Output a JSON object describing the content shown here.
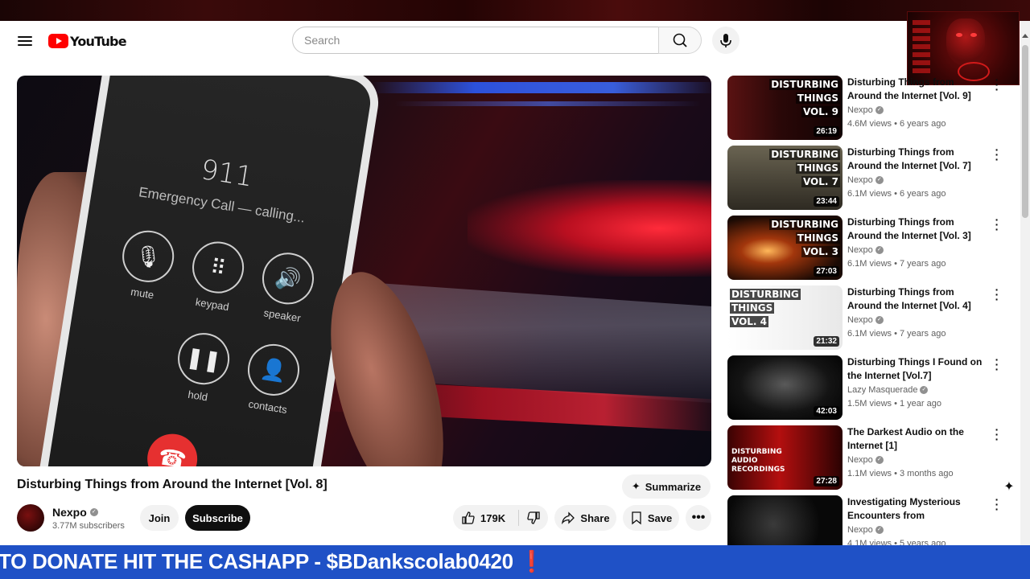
{
  "header": {
    "logo_text": "YouTube",
    "search_placeholder": "Search"
  },
  "player": {
    "call_number": "911",
    "call_status": "Emergency Call — calling...",
    "buttons": [
      "mute",
      "keypad",
      "speaker",
      "hold",
      "contacts"
    ]
  },
  "video": {
    "title": "Disturbing Things from Around the Internet [Vol. 8]",
    "summarize_label": "Summarize",
    "channel_name": "Nexpo",
    "subscribers": "3.77M subscribers",
    "join_label": "Join",
    "subscribe_label": "Subscribe",
    "likes": "179K",
    "share_label": "Share",
    "save_label": "Save"
  },
  "recommendations": [
    {
      "thumb_text": [
        "DISTURBING",
        "THINGS",
        "VOL. 9"
      ],
      "duration": "26:19",
      "title": "Disturbing Things from Around the Internet [Vol. 9]",
      "channel": "Nexpo",
      "meta": "4.6M views • 6 years ago",
      "bg": "#3a0c0c"
    },
    {
      "thumb_text": [
        "DISTURBING",
        "THINGS",
        "VOL. 7"
      ],
      "duration": "23:44",
      "title": "Disturbing Things from Around the Internet [Vol. 7]",
      "channel": "Nexpo",
      "meta": "6.1M views • 6 years ago",
      "bg": "#4a4638"
    },
    {
      "thumb_text": [
        "DISTURBING",
        "THINGS",
        "VOL. 3"
      ],
      "duration": "27:03",
      "title": "Disturbing Things from Around the Internet [Vol. 3]",
      "channel": "Nexpo",
      "meta": "6.1M views • 7 years ago",
      "bg": "#2a1408"
    },
    {
      "thumb_text": [
        "DISTURBING",
        "THINGS",
        "VOL. 4"
      ],
      "duration": "21:32",
      "title": "Disturbing Things from Around the Internet [Vol. 4]",
      "channel": "Nexpo",
      "meta": "6.1M views • 7 years ago",
      "bg": "#f4f4f4"
    },
    {
      "thumb_text": [],
      "duration": "42:03",
      "title": "Disturbing Things I Found on the Internet [Vol.7]",
      "channel": "Lazy Masquerade",
      "meta": "1.5M views • 1 year ago",
      "bg": "#111111"
    },
    {
      "thumb_text": [
        "DISTURBING",
        "AUDIO",
        "RECORDINGS"
      ],
      "duration": "27:28",
      "title": "The Darkest Audio on the Internet [1]",
      "channel": "Nexpo",
      "meta": "1.1M views • 3 months ago",
      "bg": "#8a0a0a"
    },
    {
      "thumb_text": [],
      "duration": "",
      "title": "Investigating Mysterious Encounters from Randonautica",
      "channel": "Nexpo",
      "meta": "4.1M views • 5 years ago",
      "bg": "#0c0c0c"
    }
  ],
  "ticker": {
    "text": "TO DONATE HIT THE CASHAPP - $BDankscolab0420",
    "mark": "❗"
  },
  "colors": {
    "accent_red": "#ff0000",
    "ticker_blue": "#1f51c6",
    "subscribe_bg": "#0f0f0f"
  }
}
